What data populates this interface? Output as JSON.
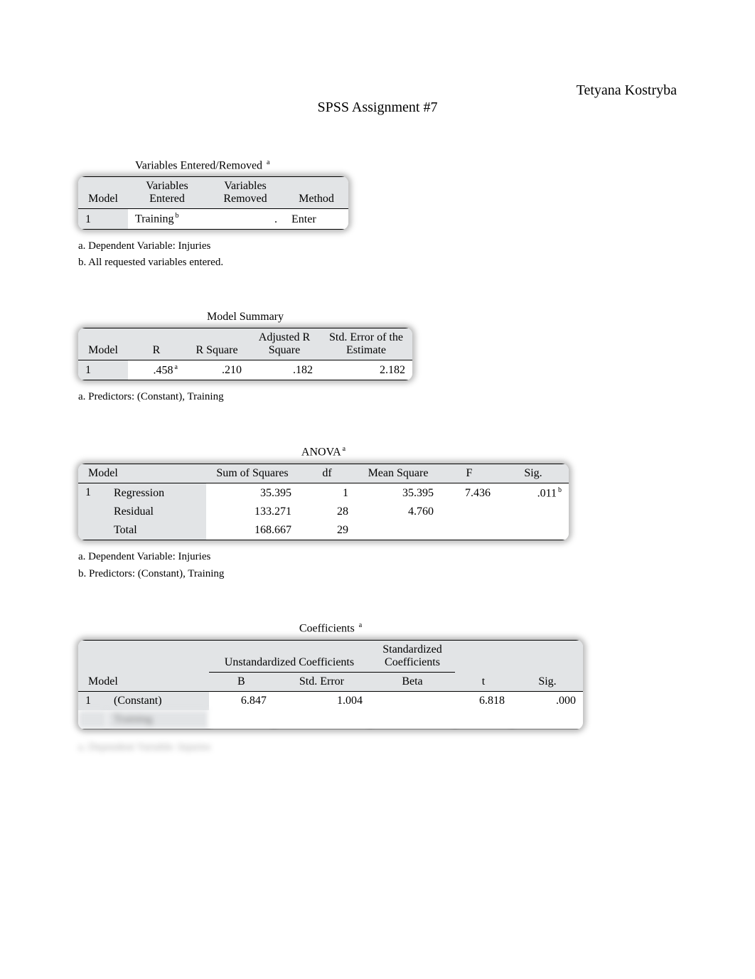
{
  "author": "Tetyana Kostryba",
  "title": "SPSS Assignment #7",
  "varent": {
    "caption": "Variables Entered/Removed",
    "caption_sup": "a",
    "headers": [
      "Model",
      "Variables Entered",
      "Variables Removed",
      "Method"
    ],
    "row": {
      "model": "1",
      "entered": "Training",
      "entered_sup": "b",
      "removed": ".",
      "method": "Enter"
    },
    "footnotes": [
      "a. Dependent Variable: Injuries",
      "b. All requested variables entered."
    ]
  },
  "modsum": {
    "caption": "Model Summary",
    "headers": [
      "Model",
      "R",
      "R Square",
      "Adjusted R Square",
      "Std. Error of the Estimate"
    ],
    "row": {
      "model": "1",
      "r": ".458",
      "r_sup": "a",
      "rsq": ".210",
      "adjrsq": ".182",
      "see": "2.182"
    },
    "footnotes": [
      "a. Predictors: (Constant), Training"
    ]
  },
  "anova": {
    "caption": "ANOVA",
    "caption_sup": "a",
    "headers": [
      "Model",
      "Sum of Squares",
      "df",
      "Mean Square",
      "F",
      "Sig."
    ],
    "rows": [
      {
        "model": "1",
        "label": "Regression",
        "ss": "35.395",
        "df": "1",
        "ms": "35.395",
        "f": "7.436",
        "sig": ".011",
        "sig_sup": "b"
      },
      {
        "model": "",
        "label": "Residual",
        "ss": "133.271",
        "df": "28",
        "ms": "4.760",
        "f": "",
        "sig": "",
        "sig_sup": ""
      },
      {
        "model": "",
        "label": "Total",
        "ss": "168.667",
        "df": "29",
        "ms": "",
        "f": "",
        "sig": "",
        "sig_sup": ""
      }
    ],
    "footnotes": [
      "a. Dependent Variable: Injuries",
      "b. Predictors: (Constant), Training"
    ]
  },
  "coef": {
    "caption": "Coefficients",
    "caption_sup": "a",
    "group_headers": {
      "unstd": "Unstandardized Coefficients",
      "std": "Standardized Coefficients"
    },
    "sub_headers": [
      "Model",
      "B",
      "Std. Error",
      "Beta",
      "t",
      "Sig."
    ],
    "rows": [
      {
        "model": "1",
        "label": "(Constant)",
        "b": "6.847",
        "se": "1.004",
        "beta": "",
        "t": "6.818",
        "sig": ".000"
      },
      {
        "model": "",
        "label": "Training",
        "b": "",
        "se": "",
        "beta": "",
        "t": "",
        "sig": ""
      }
    ],
    "hidden_footnote": "a. Dependent Variable: Injuries"
  },
  "chart_data": [
    {
      "type": "table",
      "title": "Variables Entered/Removed",
      "columns": [
        "Model",
        "Variables Entered",
        "Variables Removed",
        "Method"
      ],
      "rows": [
        [
          "1",
          "Training",
          ".",
          "Enter"
        ]
      ]
    },
    {
      "type": "table",
      "title": "Model Summary",
      "columns": [
        "Model",
        "R",
        "R Square",
        "Adjusted R Square",
        "Std. Error of the Estimate"
      ],
      "rows": [
        [
          "1",
          ".458",
          ".210",
          ".182",
          "2.182"
        ]
      ]
    },
    {
      "type": "table",
      "title": "ANOVA",
      "columns": [
        "Model",
        "",
        "Sum of Squares",
        "df",
        "Mean Square",
        "F",
        "Sig."
      ],
      "rows": [
        [
          "1",
          "Regression",
          "35.395",
          "1",
          "35.395",
          "7.436",
          ".011"
        ],
        [
          "",
          "Residual",
          "133.271",
          "28",
          "4.760",
          "",
          ""
        ],
        [
          "",
          "Total",
          "168.667",
          "29",
          "",
          "",
          ""
        ]
      ]
    },
    {
      "type": "table",
      "title": "Coefficients",
      "columns": [
        "Model",
        "",
        "B",
        "Std. Error",
        "Beta",
        "t",
        "Sig."
      ],
      "rows": [
        [
          "1",
          "(Constant)",
          "6.847",
          "1.004",
          "",
          "6.818",
          ".000"
        ],
        [
          "",
          "Training",
          "",
          "",
          "",
          "",
          ""
        ]
      ]
    }
  ]
}
